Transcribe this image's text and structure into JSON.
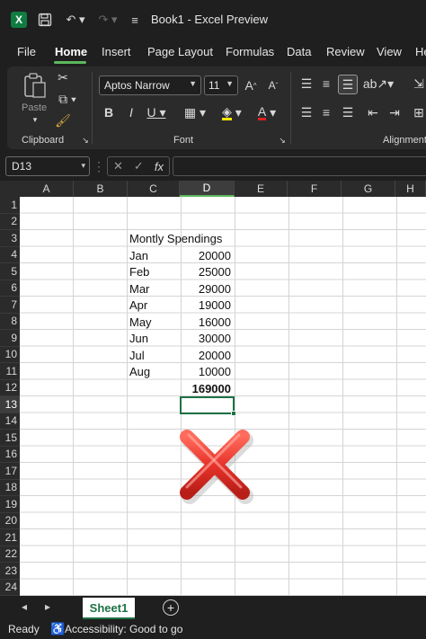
{
  "titlebar": {
    "app_icon": "excel-logo",
    "doc_title": "Book1 - Excel Preview"
  },
  "tabs": [
    "File",
    "Home",
    "Insert",
    "Page Layout",
    "Formulas",
    "Data",
    "Review",
    "View",
    "He"
  ],
  "ribbon": {
    "clipboard": {
      "paste_label": "Paste",
      "group_label": "Clipboard"
    },
    "font": {
      "font_name": "Aptos Narrow",
      "font_size": "11",
      "group_label": "Font"
    },
    "alignment": {
      "group_label": "Alignment"
    }
  },
  "formula_bar": {
    "name_box": "D13",
    "fx": "fx"
  },
  "columns": [
    "A",
    "B",
    "C",
    "D",
    "E",
    "F",
    "G",
    "H"
  ],
  "rows": [
    "1",
    "2",
    "3",
    "4",
    "5",
    "6",
    "7",
    "8",
    "9",
    "10",
    "11",
    "12",
    "13",
    "14",
    "15",
    "16",
    "17",
    "18",
    "19",
    "20",
    "21",
    "22",
    "23",
    "24"
  ],
  "sheet": {
    "title": "Montly Spendings",
    "months": [
      "Jan",
      "Feb",
      "Mar",
      "Apr",
      "May",
      "Jun",
      "Jul",
      "Aug"
    ],
    "values": [
      "20000",
      "25000",
      "29000",
      "19000",
      "16000",
      "30000",
      "20000",
      "10000"
    ],
    "total": "169000"
  },
  "sheet_tabs": {
    "active": "Sheet1"
  },
  "status": {
    "ready": "Ready",
    "accessibility": "Accessibility: Good to go"
  }
}
